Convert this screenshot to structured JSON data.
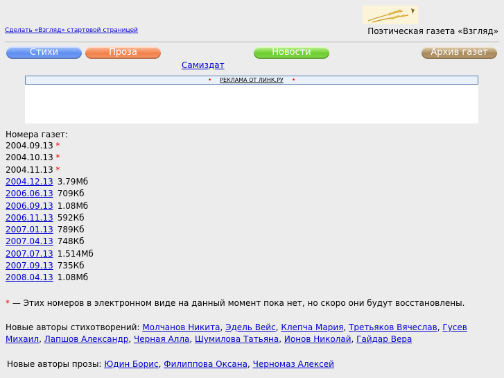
{
  "header": {
    "make_home_link": "Сделать «Взгляд» стартовой страницей",
    "site_title": "Поэтическая газета «Взгляд»"
  },
  "nav": {
    "poems": "Стихи",
    "prose": "Проза",
    "news": "Новости",
    "archive": "Архив газет",
    "samizdat": "Самиздат"
  },
  "ad": {
    "label": "РЕКЛАМА ОТ ЛИНК.РУ",
    "bullet": "•"
  },
  "issues": {
    "title": "Номера газет:",
    "missing_marker": "*",
    "items": [
      {
        "date": "2004.09.13",
        "size": "",
        "available": false
      },
      {
        "date": "2004.10.13",
        "size": "",
        "available": false
      },
      {
        "date": "2004.11.13",
        "size": "",
        "available": false
      },
      {
        "date": "2004.12.13",
        "size": "3.79Мб",
        "available": true
      },
      {
        "date": "2006.06.13",
        "size": "709Кб",
        "available": true
      },
      {
        "date": "2006.09.13",
        "size": "1.08Мб",
        "available": true
      },
      {
        "date": "2006.11.13",
        "size": "592Кб",
        "available": true
      },
      {
        "date": "2007.01.13",
        "size": "789Кб",
        "available": true
      },
      {
        "date": "2007.04.13",
        "size": "748Кб",
        "available": true
      },
      {
        "date": "2007.07.13",
        "size": "1.514Мб",
        "available": true
      },
      {
        "date": "2007.09.13",
        "size": "735Кб",
        "available": true
      },
      {
        "date": "2008.04.13",
        "size": "1.08Мб",
        "available": true
      }
    ]
  },
  "note": {
    "marker": "*",
    "text": " — Этих номеров в электронном виде на данный момент пока нет, но скоро они будут восстановлены."
  },
  "new_poets": {
    "label": "Новые авторы стихотворений:",
    "authors": [
      "Молчанов Никита",
      "Эдель Вейс",
      "Клепча Мария",
      "Третьяков Вячеслав",
      "Гусев Михаил",
      "Лапшов Александр",
      "Черная Алла",
      "Шумилова Татьяна",
      "Ионов Николай",
      "Гайдар Вера"
    ]
  },
  "new_prose": {
    "label": "Новые авторы прозы:",
    "authors": [
      "Юдин Борис",
      "Филиппова Оксана",
      "Черномаз Алексей"
    ]
  },
  "colors": {
    "background": "#ececec",
    "link": "#0000cc",
    "marker": "#ee0000",
    "poems_pill": "#5e8ef0",
    "prose_pill": "#f1804a",
    "news_pill": "#6ccd2f",
    "archive_pill": "#a8895c"
  }
}
